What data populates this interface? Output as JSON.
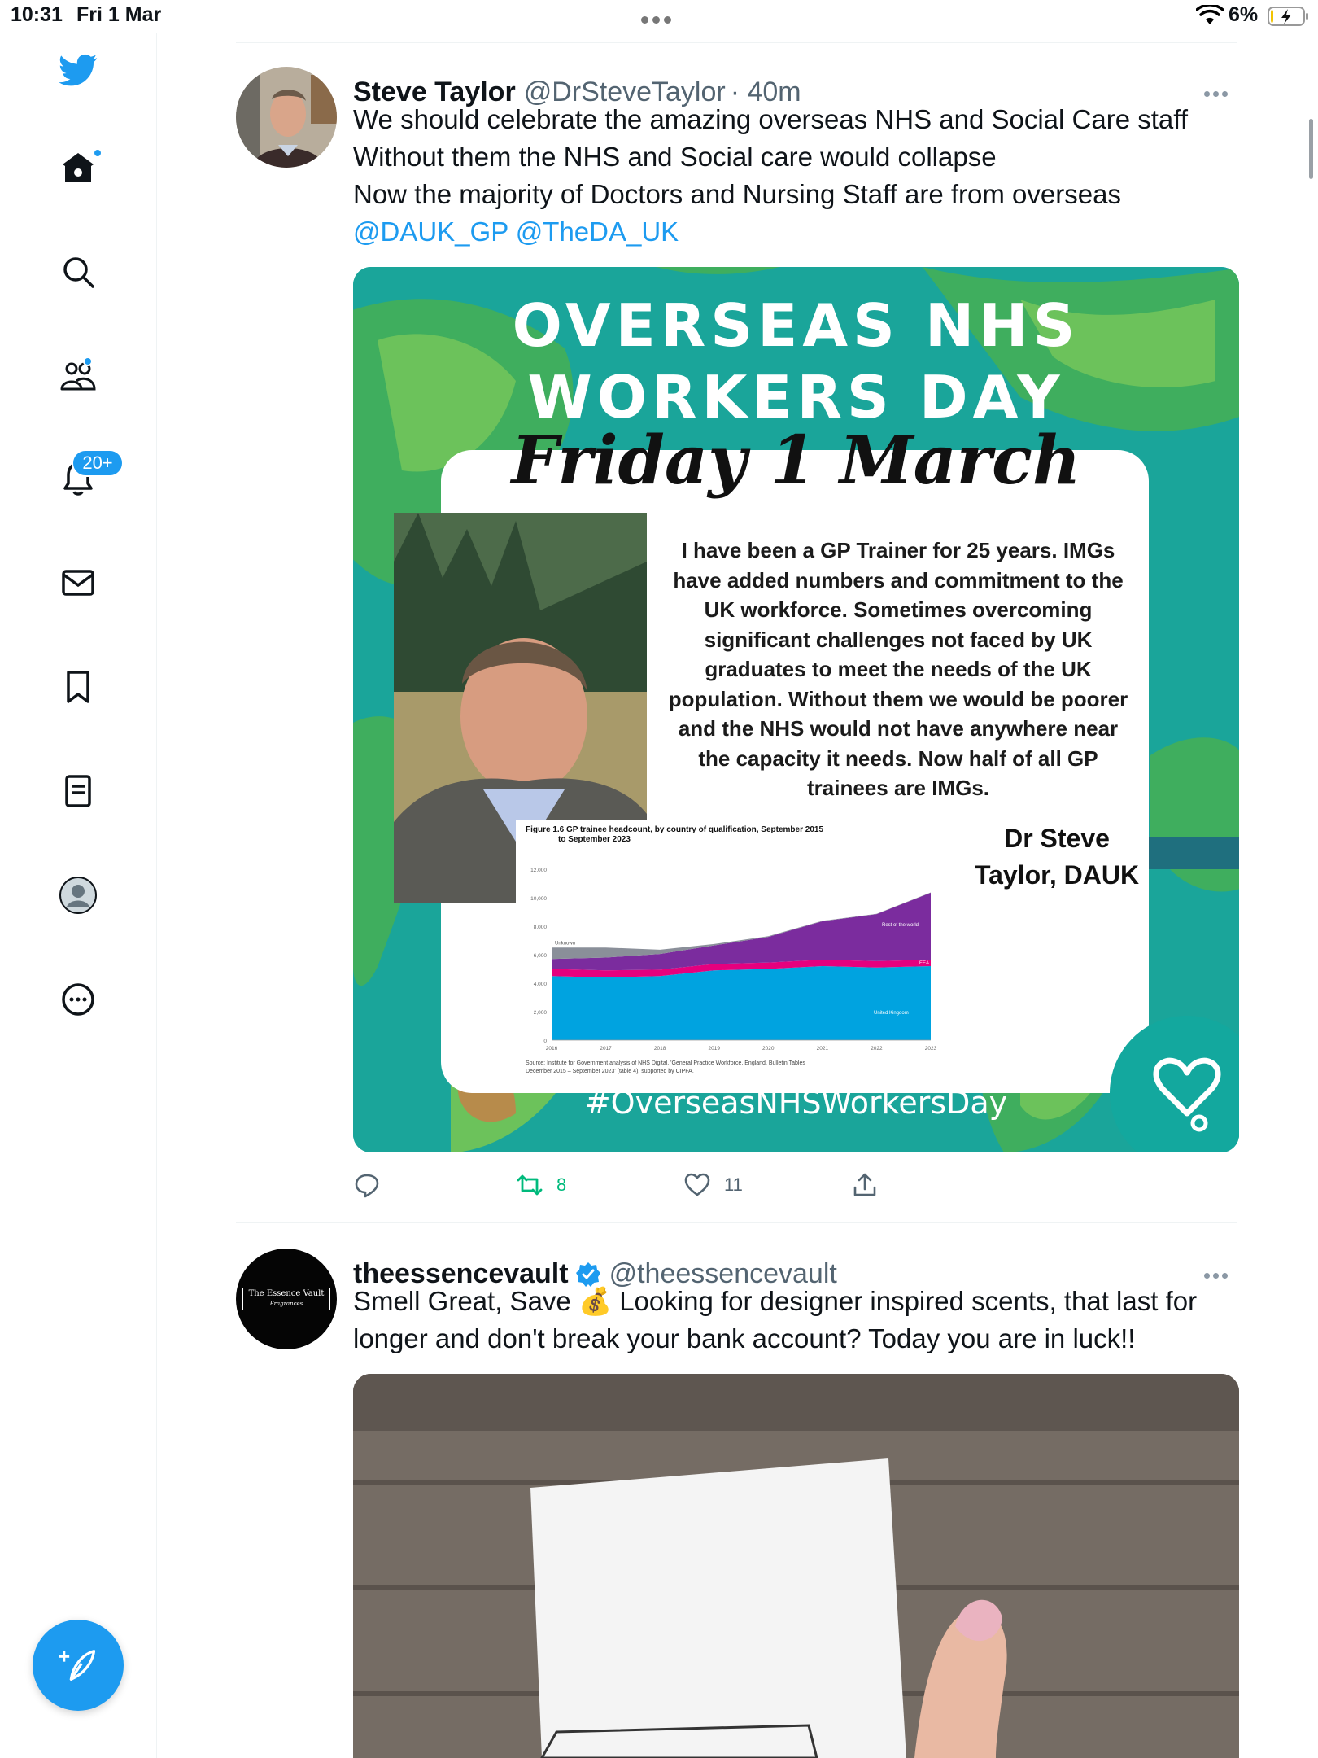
{
  "status_bar": {
    "time": "10:31",
    "date": "Fri 1 Mar",
    "battery_percent": "6%",
    "battery_level": 0.06,
    "charging": true
  },
  "sidebar": {
    "items": [
      {
        "id": "logo",
        "icon": "twitter-bird-icon"
      },
      {
        "id": "home",
        "icon": "home-icon",
        "has_dot": true
      },
      {
        "id": "explore",
        "icon": "search-icon"
      },
      {
        "id": "communities",
        "icon": "communities-icon",
        "has_dot": true
      },
      {
        "id": "notifications",
        "icon": "bell-icon",
        "badge": "20+"
      },
      {
        "id": "messages",
        "icon": "envelope-icon"
      },
      {
        "id": "bookmarks",
        "icon": "bookmark-icon"
      },
      {
        "id": "lists",
        "icon": "list-icon"
      },
      {
        "id": "profile",
        "icon": "profile-avatar-icon"
      },
      {
        "id": "more",
        "icon": "more-circle-icon"
      }
    ],
    "compose_icon": "compose-feather-icon"
  },
  "colors": {
    "accent": "#1d9bf0",
    "retweet_green": "#00ba7c",
    "secondary_text": "#536471",
    "poster_teal": "#1aa59a"
  },
  "tweets": [
    {
      "name": "Steve Taylor",
      "handle": "@DrSteveTaylor",
      "time": "· 40m",
      "lines": [
        "We should celebrate the amazing overseas NHS and Social Care staff",
        "Without them the NHS and Social care would collapse",
        "Now the majority of Doctors and Nursing Staff are from overseas"
      ],
      "mentions": [
        "@DAUK_GP",
        "@TheDA_UK"
      ],
      "media": {
        "title_line1": "OVERSEAS NHS",
        "title_line2": "WORKERS DAY",
        "date": "Friday 1 March",
        "quote": "I have been a GP Trainer for 25 years. IMGs have added numbers and commitment to the UK workforce. Sometimes overcoming significant challenges not faced by UK graduates to meet the needs of the UK population. Without them we would be poorer and the NHS would not have anywhere near the capacity it needs. Now half of all GP trainees are IMGs.",
        "author_line1": "Dr Steve",
        "author_line2": "Taylor, DAUK",
        "hashtag": "#OverseasNHSWorkersDay"
      },
      "stats": {
        "replies": "",
        "retweets": "8",
        "likes": "11"
      }
    },
    {
      "name": "theessencevault",
      "handle": "@theessencevault",
      "verified": true,
      "avatar_text_line1": "The Essence Vault",
      "avatar_text_line2": "Fragrances",
      "lines": [
        "Smell Great, Save 💰 Looking for designer inspired scents, that last for",
        "longer and don't break your bank account? Today you are in luck!!"
      ]
    }
  ],
  "chart_data": {
    "type": "area",
    "title": "Figure 1.6 GP trainee headcount, by country of qualification, September 2015 to September 2023",
    "source": "Source: Institute for Government analysis of NHS Digital, 'General Practice Workforce, England, Bulletin Tables December 2015 – September 2023' (table 4), supported by CIPFA.",
    "x": [
      "2016",
      "2017",
      "2018",
      "2019",
      "2020",
      "2021",
      "2022",
      "2023"
    ],
    "yticks": [
      "0",
      "2,000",
      "4,000",
      "6,000",
      "8,000",
      "10,000",
      "12,000"
    ],
    "ylim": [
      0,
      12000
    ],
    "series": [
      {
        "name": "United Kingdom",
        "color": "#00a3e0",
        "values": [
          4500,
          4400,
          4500,
          4900,
          5000,
          5200,
          5100,
          5200
        ]
      },
      {
        "name": "EEA",
        "color": "#e6007e",
        "values": [
          500,
          500,
          450,
          450,
          450,
          450,
          450,
          450
        ]
      },
      {
        "name": "Rest of the world",
        "color": "#7b2c9e",
        "values": [
          700,
          900,
          1100,
          1300,
          1800,
          2700,
          3300,
          4700
        ]
      },
      {
        "name": "Unknown",
        "color": "#8a8f99",
        "values": [
          800,
          700,
          300,
          100,
          50,
          30,
          20,
          20
        ]
      }
    ]
  }
}
